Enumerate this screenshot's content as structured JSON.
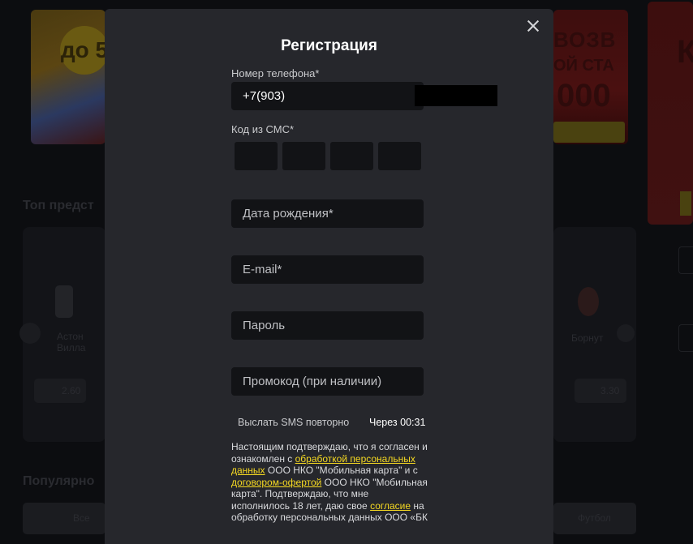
{
  "background": {
    "banner_left_badge": "до 5",
    "banner_mid_line1": "ВОЗВ",
    "banner_mid_line2": "ОЙ СТА",
    "banner_mid_line3": "000",
    "banner_right_text": "К",
    "heading_top": "Топ предст",
    "heading_bottom": "Популярно",
    "team_left": "Астон Вилла",
    "team_right": "Борнут",
    "odd_left": "2.60",
    "odd_right": "3.30",
    "tab_left": "Все",
    "tab_right": "Футбол"
  },
  "modal": {
    "title": "Регистрация",
    "phone_label": "Номер телефона*",
    "phone_value": "+7(903) ",
    "sms_label": "Код из СМС*",
    "sms_boxes": [
      "",
      "",
      "",
      ""
    ],
    "birthdate_placeholder": "Дата рождения*",
    "email_placeholder": "E-mail*",
    "password_placeholder": "Пароль",
    "promo_placeholder": "Промокод (при наличии)",
    "resend_label": "Выслать SMS повторно",
    "timer_text": "Через 00:31",
    "consent": {
      "part1": "Настоящим подтверждаю, что я согласен и ознакомлен с ",
      "link1": "обработкой персональных данных",
      "part2": " ООО НКО \"Мобильная карта\" и с ",
      "link2": "договором-офертой",
      "part3": " ООО НКО \"Мобильная карта\". Подтверждаю, что мне исполнилось 18 лет, даю свое ",
      "link3": "согласие",
      "part4": " на обработку персональных данных ООО «БК"
    }
  },
  "colors": {
    "overlay_bg": "#0c0d10",
    "modal_bg": "#26272c",
    "input_bg": "#121316",
    "link": "#f5d922"
  }
}
